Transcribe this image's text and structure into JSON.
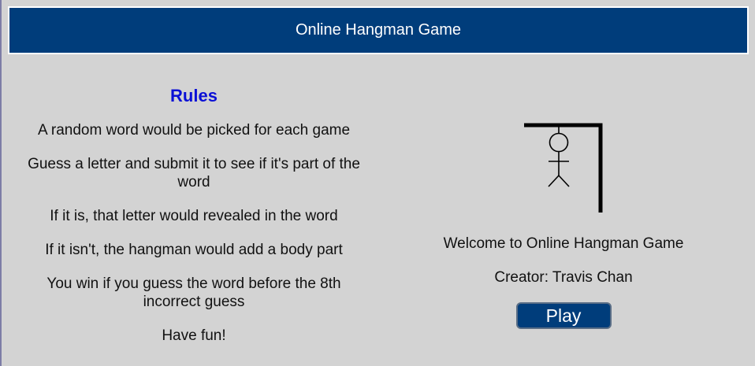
{
  "header": {
    "title": "Online Hangman Game"
  },
  "rules": {
    "title": "Rules",
    "items": [
      "A random word would be picked for each game",
      "Guess a letter and submit it to see if it's part of the word",
      "If it is, that letter would revealed in the word",
      "If it isn't, the hangman would add a body part",
      "You win if you guess the word before the 8th incorrect guess",
      "Have fun!"
    ]
  },
  "intro": {
    "welcome": "Welcome to Online Hangman Game",
    "creator": "Creator: Travis Chan",
    "play_label": "Play"
  },
  "colors": {
    "background": "#d3d3d3",
    "header": "#003d7b",
    "rules_title": "#0b10d6",
    "button": "#003d7b"
  },
  "icons": {
    "gallows": "hangman-gallows-icon"
  }
}
